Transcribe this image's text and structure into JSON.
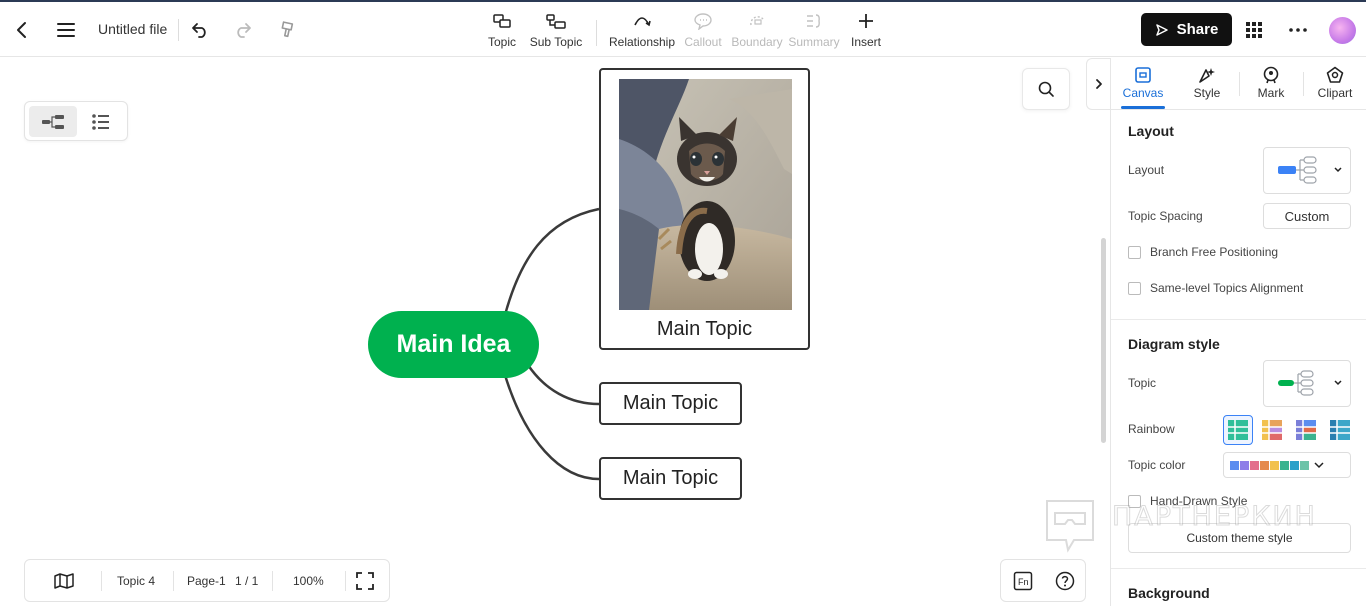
{
  "toolbar": {
    "file_name": "Untitled file",
    "tools": [
      {
        "label": "Topic",
        "icon": "topic-icon",
        "enabled": true
      },
      {
        "label": "Sub Topic",
        "icon": "sub-topic-icon",
        "enabled": true
      },
      {
        "label": "Relationship",
        "icon": "relationship-icon",
        "enabled": true
      },
      {
        "label": "Callout",
        "icon": "callout-icon",
        "enabled": false
      },
      {
        "label": "Boundary",
        "icon": "boundary-icon",
        "enabled": false
      },
      {
        "label": "Summary",
        "icon": "summary-icon",
        "enabled": false
      },
      {
        "label": "Insert",
        "icon": "plus-icon",
        "enabled": true
      }
    ],
    "share_label": "Share"
  },
  "mindmap": {
    "central": "Main Idea",
    "central_color": "#00b14f",
    "topics": [
      "Main Topic",
      "Main Topic",
      "Main Topic"
    ]
  },
  "status_bar": {
    "topic_count": "Topic 4",
    "page_name": "Page-1",
    "page_index": "1 / 1",
    "zoom": "100%"
  },
  "panel": {
    "tabs": [
      {
        "label": "Canvas",
        "icon": "canvas-icon",
        "active": true
      },
      {
        "label": "Style",
        "icon": "style-icon",
        "active": false
      },
      {
        "label": "Mark",
        "icon": "mark-icon",
        "active": false
      },
      {
        "label": "Clipart",
        "icon": "clipart-icon",
        "active": false
      }
    ],
    "layout_section": "Layout",
    "layout_label": "Layout",
    "topic_spacing_label": "Topic Spacing",
    "topic_spacing_value": "Custom",
    "branch_free_label": "Branch Free Positioning",
    "same_level_label": "Same-level Topics Alignment",
    "diagram_section": "Diagram style",
    "topic_label": "Topic",
    "rainbow_label": "Rainbow",
    "topic_color_label": "Topic color",
    "hand_drawn_label": "Hand-Drawn Style",
    "custom_theme_label": "Custom theme style",
    "background_section": "Background",
    "accent": "#1a6fd8",
    "topic_colors": [
      "#5b8def",
      "#8e7ee8",
      "#e36f8d",
      "#e58a4e",
      "#f2c14e",
      "#3bb38f",
      "#2aa0c9",
      "#6cc3a8"
    ]
  },
  "watermark": "ПАРТНЕРКИН"
}
